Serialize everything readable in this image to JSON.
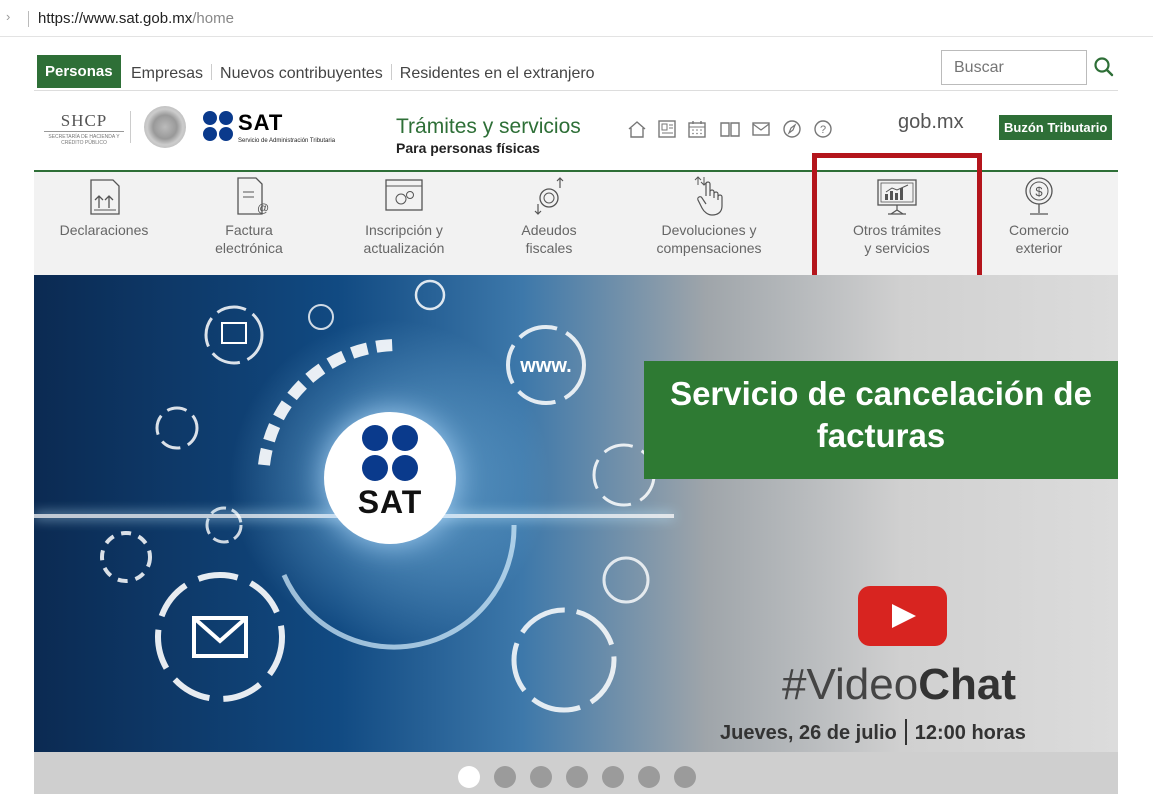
{
  "browser": {
    "url_host": "https://www.sat.gob.mx",
    "url_path": "/home"
  },
  "topnav": {
    "active_tab": "Personas",
    "links": [
      "Empresas",
      "Nuevos contribuyentes",
      "Residentes en el extranjero"
    ],
    "search_placeholder": "Buscar"
  },
  "brand": {
    "shcp": "SHCP",
    "shcp_sub": "SECRETARÍA DE HACIENDA Y CRÉDITO PÚBLICO",
    "sat": "SAT",
    "sat_sub": "Servicio de Administración Tributaria",
    "title": "Trámites y servicios",
    "subtitle": "Para personas físicas",
    "icons": [
      "home-icon",
      "document-icon",
      "calendar-icon",
      "book-icon",
      "mail-icon",
      "compass-icon",
      "help-icon"
    ],
    "gobmx": "gob.mx",
    "buzon": "Buzón Tributario"
  },
  "services": [
    {
      "line1": "Declaraciones",
      "line2": "",
      "icon": "declaraciones-icon"
    },
    {
      "line1": "Factura",
      "line2": "electrónica",
      "icon": "factura-icon"
    },
    {
      "line1": "Inscripción y",
      "line2": "actualización",
      "icon": "inscripcion-icon"
    },
    {
      "line1": "Adeudos",
      "line2": "fiscales",
      "icon": "adeudos-icon"
    },
    {
      "line1": "Devoluciones y",
      "line2": "compensaciones",
      "icon": "devoluciones-icon"
    },
    {
      "line1": "Otros trámites",
      "line2": "y servicios",
      "icon": "otros-tramites-icon"
    },
    {
      "line1": "Comercio",
      "line2": "exterior",
      "icon": "comercio-exterior-icon"
    }
  ],
  "hero": {
    "sat_word": "SAT",
    "www": "www.",
    "banner_line1": "Servicio de cancelación de",
    "banner_line2": "facturas",
    "videochat_light": "#Video",
    "videochat_bold": "Chat",
    "date": "Jueves, 26 de julio",
    "time": "12:00 horas"
  },
  "carousel": {
    "count": 7,
    "active": 0
  },
  "colors": {
    "brand_green": "#2e6f37",
    "highlight_red": "#b4151c",
    "youtube_red": "#d82420"
  }
}
